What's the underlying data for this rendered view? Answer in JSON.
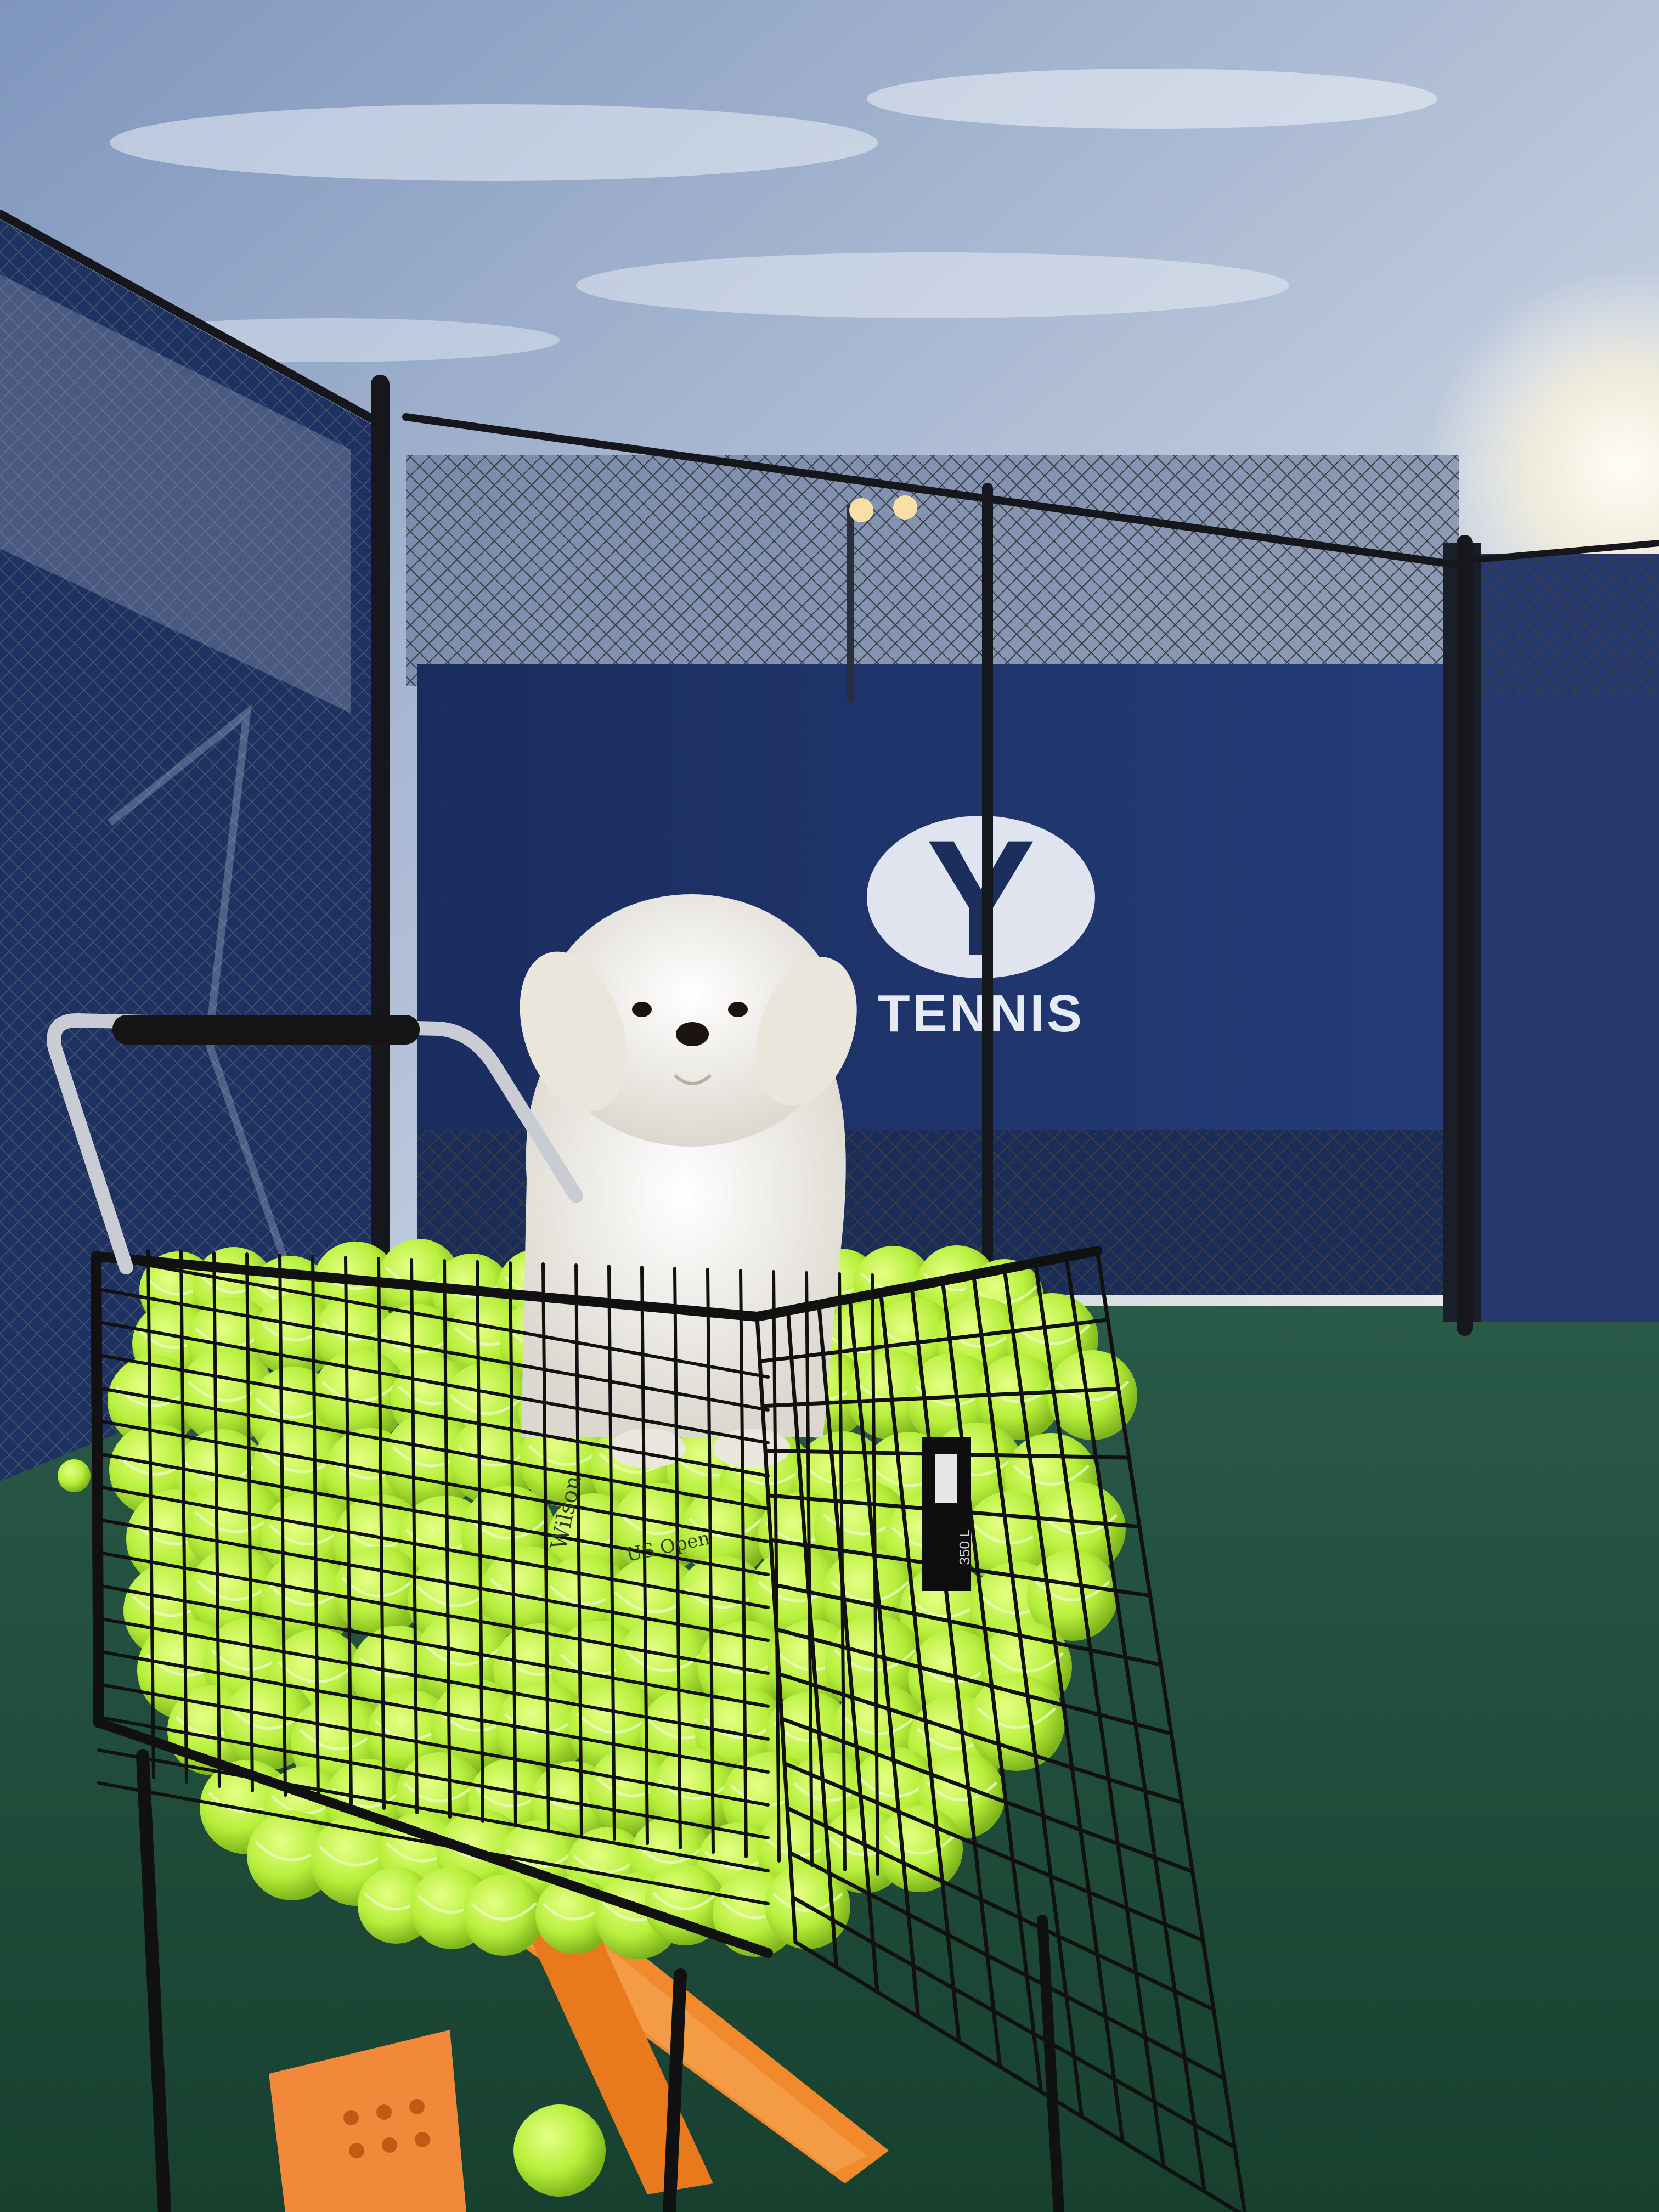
{
  "scene": {
    "banner_logo_letter": "Y",
    "banner_text": "TENNIS",
    "ball_print_1": "Wilson",
    "ball_print_2": "US Open",
    "cart_tag": "350 L"
  },
  "colors": {
    "sky_top": "#8fa4c6",
    "sky_bottom": "#e7ecf3",
    "sun": "#fffdf2",
    "windscreen_navy": "#1f3469",
    "court_green": "#1f4c3d",
    "ball_yellow": "#b9f24a",
    "cone_orange": "#f28a2e",
    "dog_white": "#f3f1ec",
    "cart_black": "#121212"
  }
}
